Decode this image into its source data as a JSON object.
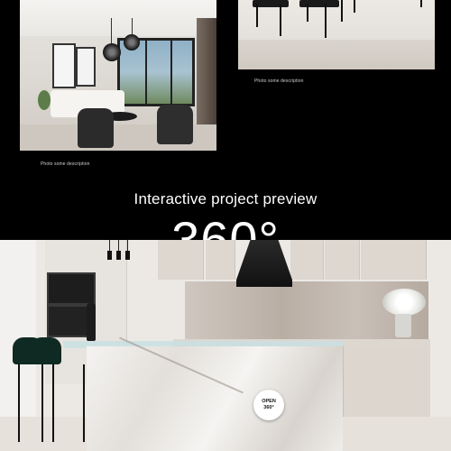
{
  "gallery": {
    "photos": [
      {
        "caption": "Photo some description"
      },
      {
        "caption": "Photo some description"
      }
    ]
  },
  "preview": {
    "heading": "Interactive project preview",
    "big_text": "360°",
    "open_button": {
      "line1": "OPEN",
      "line2": "360°"
    }
  },
  "colors": {
    "background": "#000000",
    "text": "#ffffff",
    "button_bg": "#ffffff",
    "button_text": "#111111"
  }
}
